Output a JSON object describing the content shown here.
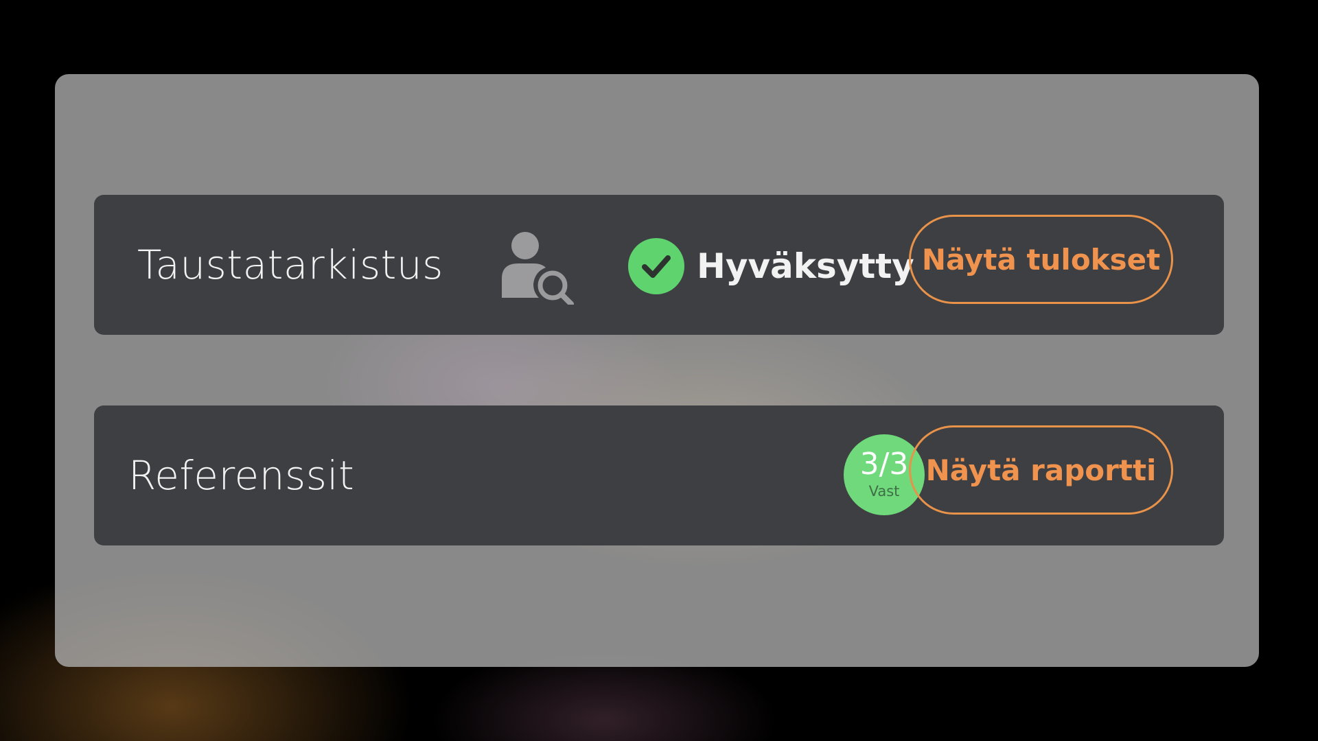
{
  "background_check": {
    "title": "Taustatarkistus",
    "status_text": "Hyväksytty",
    "status_color": "#5fd36e",
    "icon": "person-search-icon",
    "status_icon": "check-circle-icon",
    "button_label": "Näytä tulokset"
  },
  "references": {
    "title": "Referenssit",
    "count_value": "3/3",
    "count_label": "Vast",
    "badge_color": "#6fd97c",
    "button_label": "Näytä raportti"
  },
  "colors": {
    "accent": "#e8924a",
    "card_background": "#3e3f43"
  }
}
